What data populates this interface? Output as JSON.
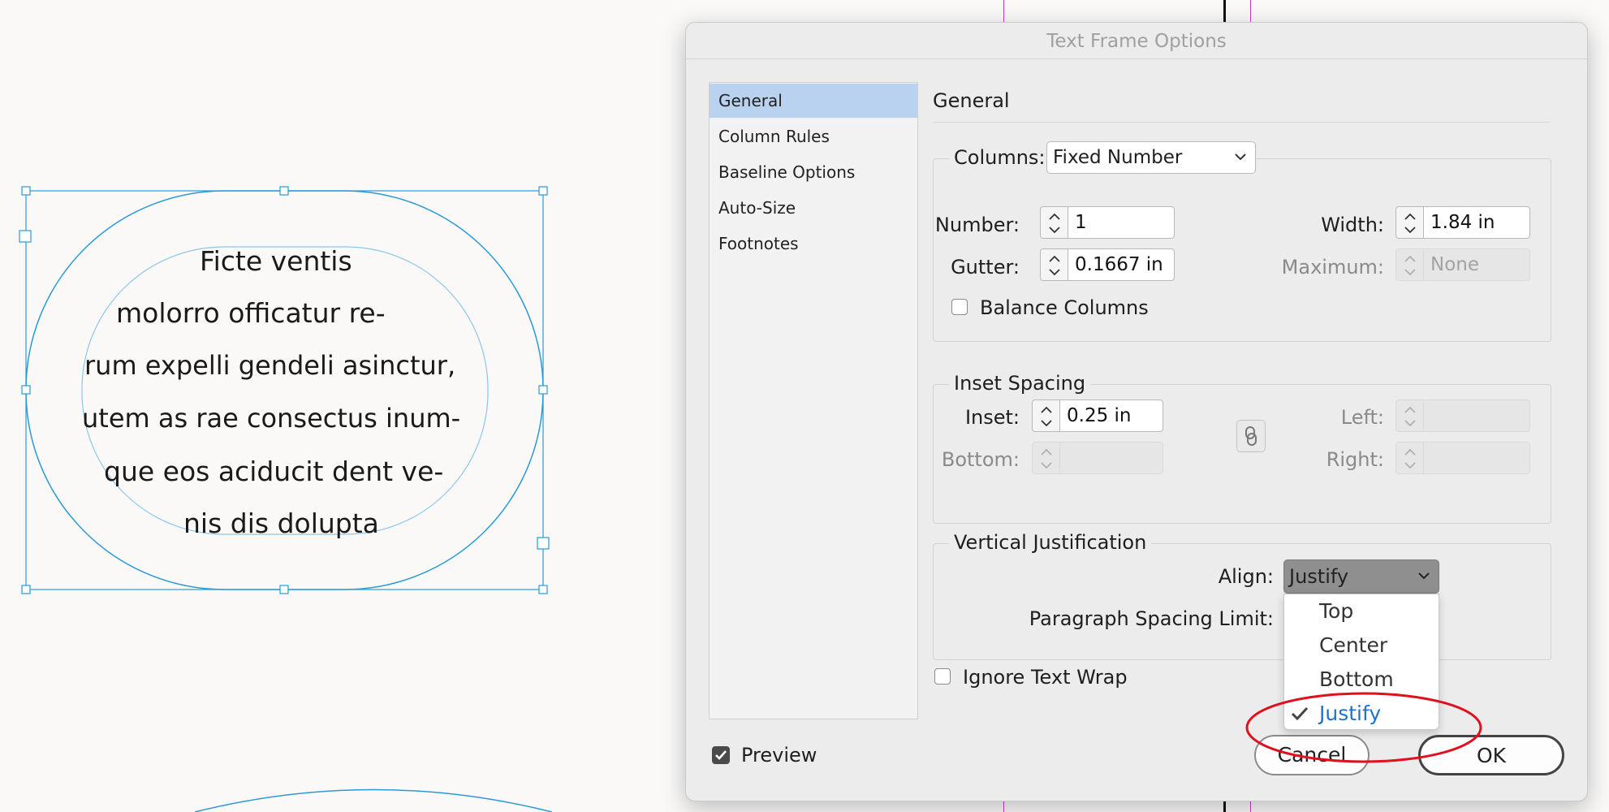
{
  "canvas": {
    "text_lines": [
      "Ficte ventis",
      "molorro officatur re-",
      "rum expelli gendeli asinctur,",
      "utem as rae consectus inum-",
      "que eos aciducit dent ve-",
      "nis dis dolupta"
    ],
    "colors": {
      "frame": "#2a9ad6",
      "guide_magenta": "#c43fbf",
      "guide_black": "#111111"
    }
  },
  "dialog": {
    "title": "Text Frame Options",
    "nav": {
      "items": [
        "General",
        "Column Rules",
        "Baseline Options",
        "Auto-Size",
        "Footnotes"
      ],
      "selected": "General"
    },
    "section_title": "General",
    "columns": {
      "label": "Columns:",
      "type_value": "Fixed Number",
      "number_label": "Number:",
      "number_value": "1",
      "width_label": "Width:",
      "width_value": "1.84 in",
      "gutter_label": "Gutter:",
      "gutter_value": "0.1667 in",
      "maximum_label": "Maximum:",
      "maximum_value": "None",
      "balance_label": "Balance Columns",
      "balance_checked": false
    },
    "inset": {
      "legend": "Inset Spacing",
      "inset_label": "Inset:",
      "inset_value": "0.25 in",
      "bottom_label": "Bottom:",
      "left_label": "Left:",
      "right_label": "Right:"
    },
    "vertical": {
      "legend": "Vertical Justification",
      "align_label": "Align:",
      "align_value": "Justify",
      "para_label": "Paragraph Spacing Limit:",
      "options": [
        "Top",
        "Center",
        "Bottom",
        "Justify"
      ],
      "selected_option": "Justify"
    },
    "ignore_wrap_label": "Ignore Text Wrap",
    "ignore_wrap_checked": false,
    "preview_label": "Preview",
    "preview_checked": true,
    "cancel_label": "Cancel",
    "ok_label": "OK",
    "accent_color": "#1f73c9",
    "annotation_color": "#e0101c"
  }
}
